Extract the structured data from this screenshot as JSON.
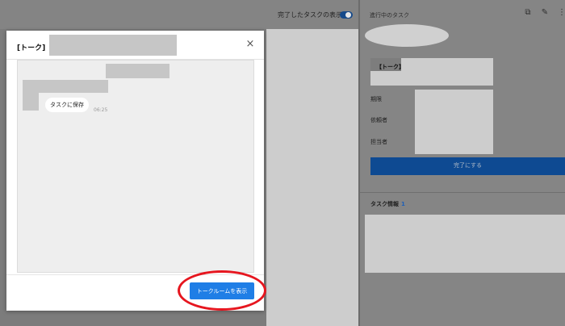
{
  "background": {
    "toggle_label": "完了したタスクの表示"
  },
  "right_panel": {
    "header": "進行中のタスク",
    "icons": [
      "external-link-icon",
      "pencil-icon",
      "more-vertical-icon"
    ],
    "title_tag": "【トーク】",
    "labels": {
      "due": "期限",
      "requester": "依頼者",
      "assignee": "担当者"
    },
    "complete_button": "完了にする",
    "task_info_title": "タスク情報",
    "task_info_count": "1"
  },
  "modal": {
    "title": "[トーク]",
    "chat": {
      "save_bubble": "タスクに保存",
      "time": "06:25"
    },
    "show_room_button": "トークルームを表示"
  },
  "colors": {
    "primary": "#1f7ee6",
    "highlight": "#e6161f",
    "overlay": "#7f7f7f"
  }
}
